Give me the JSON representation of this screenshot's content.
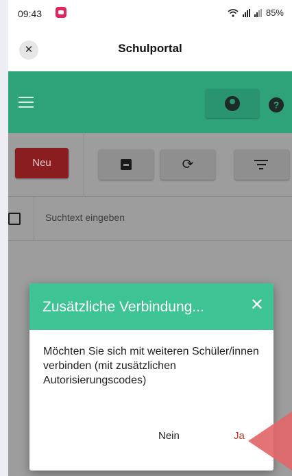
{
  "status_bar": {
    "time": "09:43",
    "battery": "85%"
  },
  "header": {
    "close_icon": "close-icon",
    "title": "Schulportal"
  },
  "app_bar": {
    "menu_icon": "hamburger-menu-icon",
    "user_icon": "account-circle-icon",
    "help_icon": "help-circle-icon",
    "help_glyph": "?"
  },
  "toolbar": {
    "new_label": "Neu",
    "archive_icon": "archive-icon",
    "refresh_icon": "refresh-icon",
    "refresh_glyph": "⟳",
    "filter_icon": "filter-icon"
  },
  "search": {
    "placeholder": "Suchtext eingeben"
  },
  "dialog": {
    "title": "Zusätzliche Verbindung...",
    "close_glyph": "✕",
    "message": "Möchten Sie sich mit weiteren Schüler/innen verbinden (mit zusätzlichen Autorisierungscodes)",
    "no_label": "Nein",
    "yes_label": "Ja"
  },
  "colors": {
    "app_green": "#2ea279",
    "dialog_green": "#3ec494",
    "new_red": "#8a1d1f",
    "yes_red": "#c0392b",
    "pointer": "#e2676a"
  }
}
